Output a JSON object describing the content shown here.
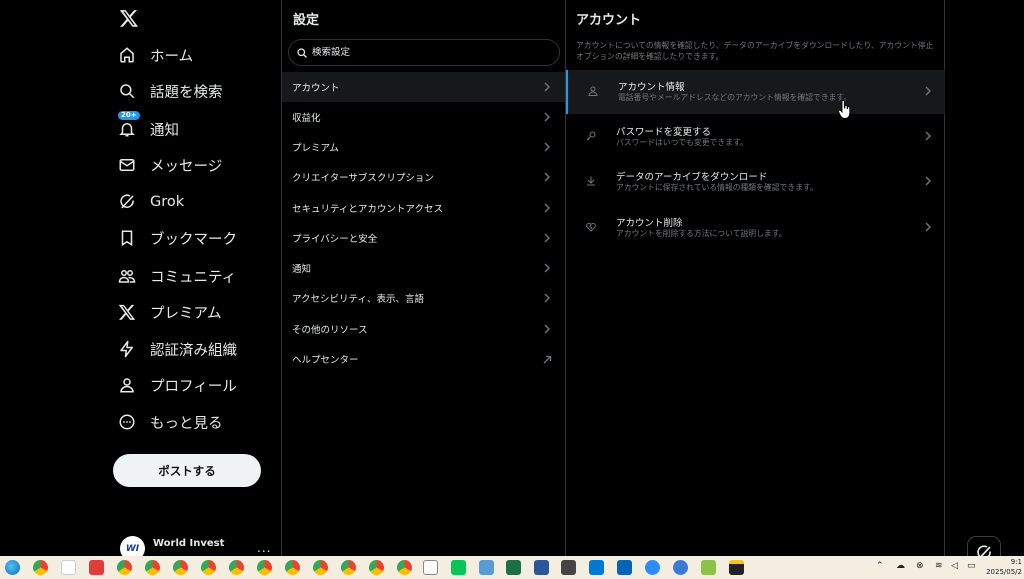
{
  "nav": {
    "items": [
      {
        "label": "ホーム",
        "icon": "home-icon"
      },
      {
        "label": "話題を検索",
        "icon": "search-icon"
      },
      {
        "label": "通知",
        "icon": "bell-icon",
        "badge": "20+"
      },
      {
        "label": "メッセージ",
        "icon": "mail-icon"
      },
      {
        "label": "Grok",
        "icon": "grok-icon"
      },
      {
        "label": "ブックマーク",
        "icon": "bookmark-icon"
      },
      {
        "label": "コミュニティ",
        "icon": "community-icon"
      },
      {
        "label": "プレミアム",
        "icon": "x-premium-icon"
      },
      {
        "label": "認証済み組織",
        "icon": "lightning-icon"
      },
      {
        "label": "プロフィール",
        "icon": "profile-icon"
      },
      {
        "label": "もっと見る",
        "icon": "more-circle-icon"
      }
    ],
    "post_button": "ポストする",
    "account": {
      "name": "World Invest",
      "more": "..."
    }
  },
  "settings": {
    "title": "設定",
    "search_placeholder": "検索設定",
    "items": [
      {
        "label": "アカウント",
        "active": true,
        "arrow": "chevron"
      },
      {
        "label": "収益化",
        "arrow": "chevron"
      },
      {
        "label": "プレミアム",
        "arrow": "chevron"
      },
      {
        "label": "クリエイターサブスクリプション",
        "arrow": "chevron"
      },
      {
        "label": "セキュリティとアカウントアクセス",
        "arrow": "chevron"
      },
      {
        "label": "プライバシーと安全",
        "arrow": "chevron"
      },
      {
        "label": "通知",
        "arrow": "chevron"
      },
      {
        "label": "アクセシビリティ、表示、言語",
        "arrow": "chevron"
      },
      {
        "label": "その他のリソース",
        "arrow": "chevron"
      },
      {
        "label": "ヘルプセンター",
        "arrow": "external"
      }
    ]
  },
  "account_panel": {
    "title": "アカウント",
    "description": "アカウントについての情報を確認したり、データのアーカイブをダウンロードしたり、アカウント停止オプションの詳細を確認したりできます。",
    "rows": [
      {
        "title": "アカウント情報",
        "subtitle": "電話番号やメールアドレスなどのアカウント情報を確認できます。",
        "icon": "person-icon",
        "active": true
      },
      {
        "title": "パスワードを変更する",
        "subtitle": "パスワードはいつでも変更できます。",
        "icon": "key-icon"
      },
      {
        "title": "データのアーカイブをダウンロード",
        "subtitle": "アカウントに保存されている情報の種類を確認できます。",
        "icon": "download-icon"
      },
      {
        "title": "アカウント削除",
        "subtitle": "アカウントを削除する方法について説明します。",
        "icon": "broken-heart-icon"
      }
    ]
  },
  "taskbar": {
    "clock_time": "9:1",
    "clock_date": "2025/05/2"
  },
  "colors": {
    "background": "#000000",
    "accent": "#1d9bf0",
    "divider": "#2f3336",
    "muted_text": "#71767b",
    "active_row": "#16181c",
    "taskbar": "#f3eee0"
  }
}
